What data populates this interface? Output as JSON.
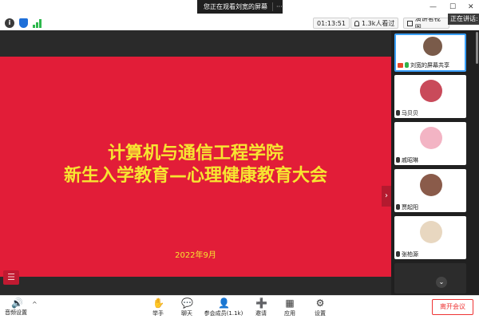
{
  "notice": {
    "text": "您正在观看刘宽的屏幕",
    "more": "···"
  },
  "window": {
    "minimize": "—",
    "maximize": "☐",
    "close": "✕"
  },
  "toolbar": {
    "info_glyph": "i",
    "clock": "01:13:51",
    "viewers": "1.3k人看过",
    "presenter_view": "演讲者视图",
    "speaking": "正在讲话:"
  },
  "slide": {
    "title_line1": "计算机与通信工程学院",
    "title_line2": "新生入学教育—心理健康教育大会",
    "date": "2022年9月",
    "list_glyph": "☰",
    "collapse_glyph": "›"
  },
  "participants": [
    {
      "name": "刘宽的屏幕共享",
      "avatar_color": "#7a5b4a",
      "sharing": true
    },
    {
      "name": "马贝贝",
      "avatar_color": "#c94a5a",
      "sharing": false
    },
    {
      "name": "戚昭琳",
      "avatar_color": "#f3b4c4",
      "sharing": false
    },
    {
      "name": "贾起阳",
      "avatar_color": "#8a5b4a",
      "sharing": false
    },
    {
      "name": "张柏源",
      "avatar_color": "#e8d7c0",
      "sharing": false
    }
  ],
  "panel": {
    "scroll_glyph": "⌄"
  },
  "bottombar": {
    "audio": {
      "icon": "🔊",
      "label": "音频设置",
      "caret": "^"
    },
    "items": [
      {
        "icon": "✋",
        "label": "举手"
      },
      {
        "icon": "💬",
        "label": "聊天"
      },
      {
        "icon": "👤",
        "label": "参会成员(1.1k)"
      },
      {
        "icon": "➕",
        "label": "邀请"
      },
      {
        "icon": "▦",
        "label": "应用"
      },
      {
        "icon": "⚙",
        "label": "设置"
      }
    ],
    "leave": "离开会议"
  },
  "colors": {
    "slide_bg": "#e21d38",
    "slide_text": "#f7e531",
    "leave_red": "#e33333",
    "active_border": "#3aa0ff"
  }
}
